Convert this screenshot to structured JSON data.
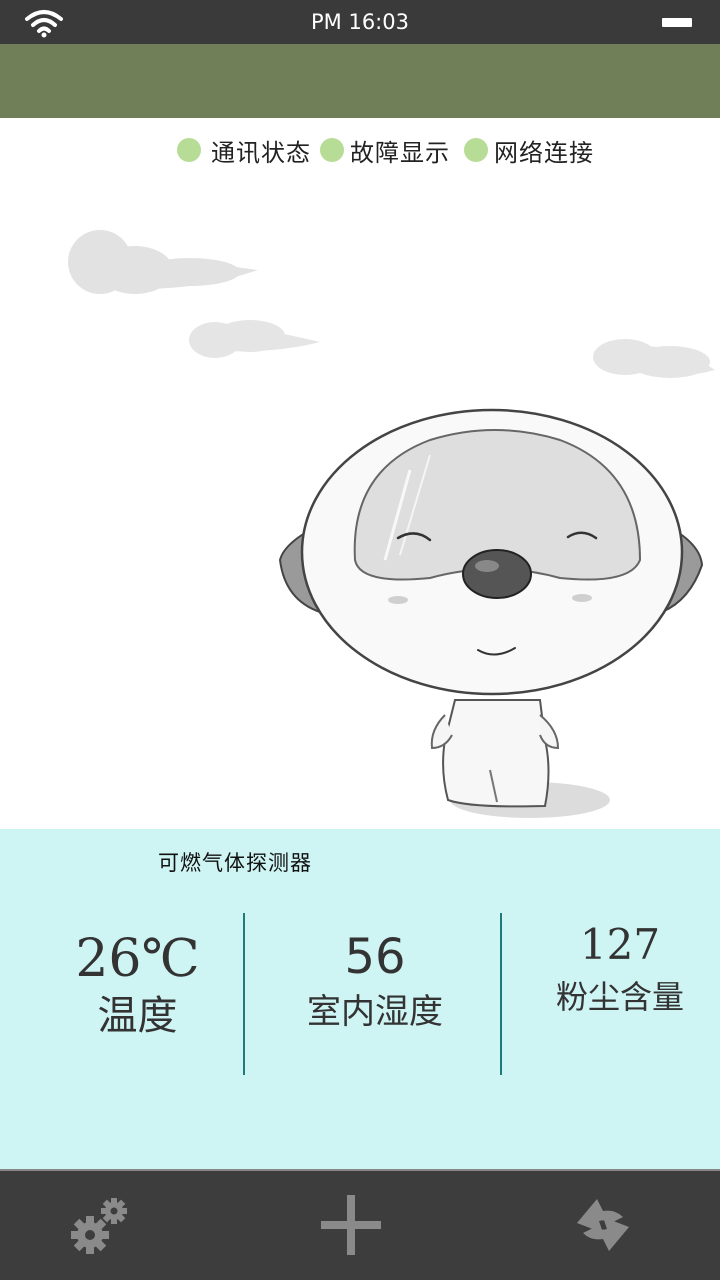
{
  "status_bar": {
    "time": "PM 16:03"
  },
  "indicators": [
    {
      "label": "通讯状态",
      "color": "#b7dc96"
    },
    {
      "label": "故障显示",
      "color": "#b7dc96"
    },
    {
      "label": "网络连接",
      "color": "#b7dc96"
    }
  ],
  "device": {
    "name": "可燃气体探测器"
  },
  "metrics": [
    {
      "value": "26℃",
      "label": "温度"
    },
    {
      "value": "56",
      "label": "室内湿度"
    },
    {
      "value": "127",
      "label": "粉尘含量"
    }
  ],
  "nav": {
    "settings_icon": "gears-icon",
    "add_icon": "plus-icon",
    "refresh_icon": "refresh-icon"
  },
  "colors": {
    "header": "#717f58",
    "panel": "#cff4f4",
    "divider": "#1f7a7a",
    "nav": "#3d3d3d",
    "status_dot": "#b7dc96"
  }
}
